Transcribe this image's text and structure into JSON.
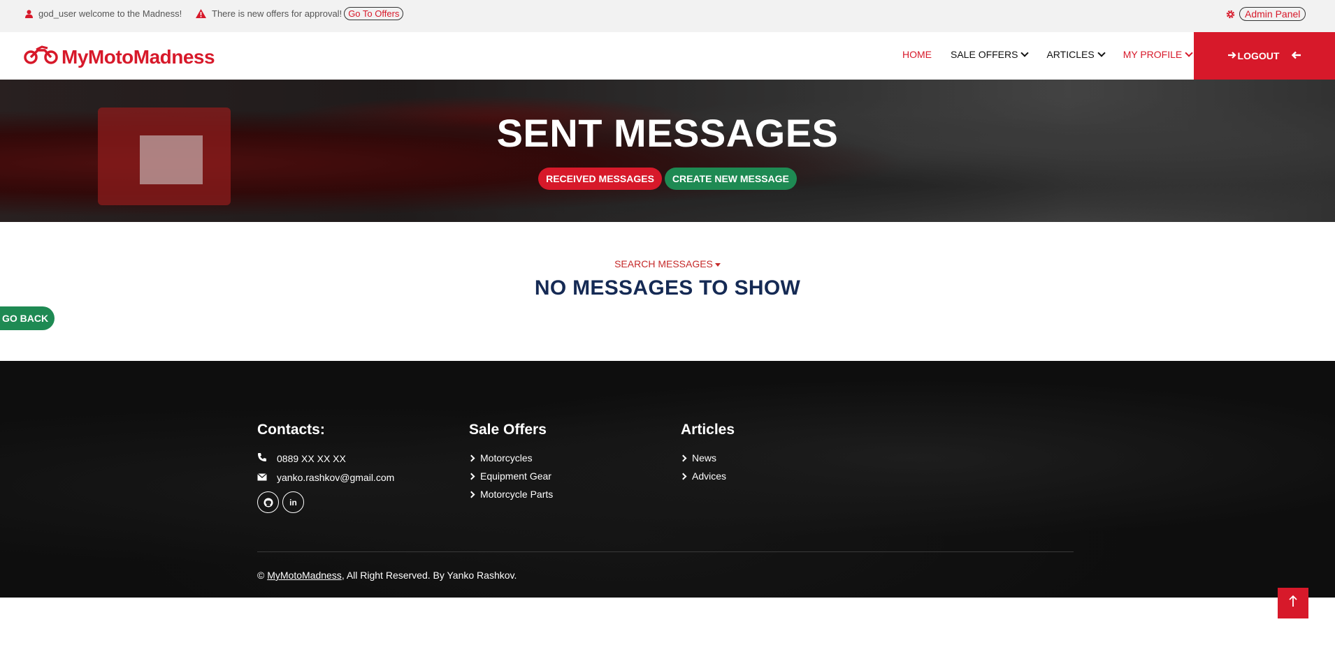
{
  "topbar": {
    "welcome": "god_user welcome to the Madness!",
    "offers_notice": "There is new offers for approval!",
    "offers_link": "Go To Offers",
    "admin_link": "Admin Panel"
  },
  "navbar": {
    "brand": "MyMotoMadness",
    "links": [
      "HOME",
      "SALE OFFERS",
      "ARTICLES",
      "MY PROFILE"
    ],
    "logout": "LOGOUT"
  },
  "hero": {
    "title": "SENT MESSAGES",
    "received_btn": "RECEIVED MESSAGES",
    "create_btn": "CREATE NEW MESSAGE"
  },
  "main": {
    "search_toggle": "SEARCH MESSAGES",
    "empty_text": "NO MESSAGES TO SHOW",
    "go_back": "GO BACK"
  },
  "footer": {
    "contacts_title": "Contacts:",
    "phone": "0889 XX XX XX",
    "email": "yanko.rashkov@gmail.com",
    "sale_title": "Sale Offers",
    "sale_items": [
      "Motorcycles",
      "Equipment Gear",
      "Motorcycle Parts"
    ],
    "articles_title": "Articles",
    "article_items": [
      "News",
      "Advices"
    ],
    "copyright_prefix": "©",
    "copyright_brand": "MyMotoMadness",
    "copyright_suffix": ", All Right Reserved. By Yanko Rashkov."
  },
  "colors": {
    "brand_red": "#d7192a",
    "green": "#1e8a53",
    "navy": "#152a54"
  },
  "icons": {
    "user": "user-icon",
    "warning": "warning-icon",
    "gear": "gear-icon",
    "motorcycle": "motorcycle-icon",
    "phone": "phone-icon",
    "envelope": "envelope-icon",
    "github": "github-icon",
    "linkedin": "linkedin-icon",
    "arrow_up": "arrow-up-icon"
  }
}
